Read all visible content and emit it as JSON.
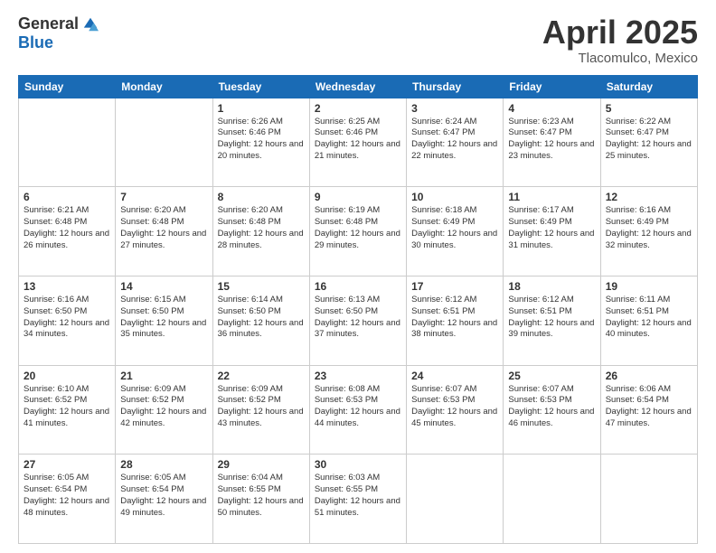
{
  "header": {
    "logo_general": "General",
    "logo_blue": "Blue",
    "month_title": "April 2025",
    "location": "Tlacomulco, Mexico"
  },
  "days_of_week": [
    "Sunday",
    "Monday",
    "Tuesday",
    "Wednesday",
    "Thursday",
    "Friday",
    "Saturday"
  ],
  "weeks": [
    [
      {
        "day": "",
        "sunrise": "",
        "sunset": "",
        "daylight": ""
      },
      {
        "day": "",
        "sunrise": "",
        "sunset": "",
        "daylight": ""
      },
      {
        "day": "1",
        "sunrise": "Sunrise: 6:26 AM",
        "sunset": "Sunset: 6:46 PM",
        "daylight": "Daylight: 12 hours and 20 minutes."
      },
      {
        "day": "2",
        "sunrise": "Sunrise: 6:25 AM",
        "sunset": "Sunset: 6:46 PM",
        "daylight": "Daylight: 12 hours and 21 minutes."
      },
      {
        "day": "3",
        "sunrise": "Sunrise: 6:24 AM",
        "sunset": "Sunset: 6:47 PM",
        "daylight": "Daylight: 12 hours and 22 minutes."
      },
      {
        "day": "4",
        "sunrise": "Sunrise: 6:23 AM",
        "sunset": "Sunset: 6:47 PM",
        "daylight": "Daylight: 12 hours and 23 minutes."
      },
      {
        "day": "5",
        "sunrise": "Sunrise: 6:22 AM",
        "sunset": "Sunset: 6:47 PM",
        "daylight": "Daylight: 12 hours and 25 minutes."
      }
    ],
    [
      {
        "day": "6",
        "sunrise": "Sunrise: 6:21 AM",
        "sunset": "Sunset: 6:48 PM",
        "daylight": "Daylight: 12 hours and 26 minutes."
      },
      {
        "day": "7",
        "sunrise": "Sunrise: 6:20 AM",
        "sunset": "Sunset: 6:48 PM",
        "daylight": "Daylight: 12 hours and 27 minutes."
      },
      {
        "day": "8",
        "sunrise": "Sunrise: 6:20 AM",
        "sunset": "Sunset: 6:48 PM",
        "daylight": "Daylight: 12 hours and 28 minutes."
      },
      {
        "day": "9",
        "sunrise": "Sunrise: 6:19 AM",
        "sunset": "Sunset: 6:48 PM",
        "daylight": "Daylight: 12 hours and 29 minutes."
      },
      {
        "day": "10",
        "sunrise": "Sunrise: 6:18 AM",
        "sunset": "Sunset: 6:49 PM",
        "daylight": "Daylight: 12 hours and 30 minutes."
      },
      {
        "day": "11",
        "sunrise": "Sunrise: 6:17 AM",
        "sunset": "Sunset: 6:49 PM",
        "daylight": "Daylight: 12 hours and 31 minutes."
      },
      {
        "day": "12",
        "sunrise": "Sunrise: 6:16 AM",
        "sunset": "Sunset: 6:49 PM",
        "daylight": "Daylight: 12 hours and 32 minutes."
      }
    ],
    [
      {
        "day": "13",
        "sunrise": "Sunrise: 6:16 AM",
        "sunset": "Sunset: 6:50 PM",
        "daylight": "Daylight: 12 hours and 34 minutes."
      },
      {
        "day": "14",
        "sunrise": "Sunrise: 6:15 AM",
        "sunset": "Sunset: 6:50 PM",
        "daylight": "Daylight: 12 hours and 35 minutes."
      },
      {
        "day": "15",
        "sunrise": "Sunrise: 6:14 AM",
        "sunset": "Sunset: 6:50 PM",
        "daylight": "Daylight: 12 hours and 36 minutes."
      },
      {
        "day": "16",
        "sunrise": "Sunrise: 6:13 AM",
        "sunset": "Sunset: 6:50 PM",
        "daylight": "Daylight: 12 hours and 37 minutes."
      },
      {
        "day": "17",
        "sunrise": "Sunrise: 6:12 AM",
        "sunset": "Sunset: 6:51 PM",
        "daylight": "Daylight: 12 hours and 38 minutes."
      },
      {
        "day": "18",
        "sunrise": "Sunrise: 6:12 AM",
        "sunset": "Sunset: 6:51 PM",
        "daylight": "Daylight: 12 hours and 39 minutes."
      },
      {
        "day": "19",
        "sunrise": "Sunrise: 6:11 AM",
        "sunset": "Sunset: 6:51 PM",
        "daylight": "Daylight: 12 hours and 40 minutes."
      }
    ],
    [
      {
        "day": "20",
        "sunrise": "Sunrise: 6:10 AM",
        "sunset": "Sunset: 6:52 PM",
        "daylight": "Daylight: 12 hours and 41 minutes."
      },
      {
        "day": "21",
        "sunrise": "Sunrise: 6:09 AM",
        "sunset": "Sunset: 6:52 PM",
        "daylight": "Daylight: 12 hours and 42 minutes."
      },
      {
        "day": "22",
        "sunrise": "Sunrise: 6:09 AM",
        "sunset": "Sunset: 6:52 PM",
        "daylight": "Daylight: 12 hours and 43 minutes."
      },
      {
        "day": "23",
        "sunrise": "Sunrise: 6:08 AM",
        "sunset": "Sunset: 6:53 PM",
        "daylight": "Daylight: 12 hours and 44 minutes."
      },
      {
        "day": "24",
        "sunrise": "Sunrise: 6:07 AM",
        "sunset": "Sunset: 6:53 PM",
        "daylight": "Daylight: 12 hours and 45 minutes."
      },
      {
        "day": "25",
        "sunrise": "Sunrise: 6:07 AM",
        "sunset": "Sunset: 6:53 PM",
        "daylight": "Daylight: 12 hours and 46 minutes."
      },
      {
        "day": "26",
        "sunrise": "Sunrise: 6:06 AM",
        "sunset": "Sunset: 6:54 PM",
        "daylight": "Daylight: 12 hours and 47 minutes."
      }
    ],
    [
      {
        "day": "27",
        "sunrise": "Sunrise: 6:05 AM",
        "sunset": "Sunset: 6:54 PM",
        "daylight": "Daylight: 12 hours and 48 minutes."
      },
      {
        "day": "28",
        "sunrise": "Sunrise: 6:05 AM",
        "sunset": "Sunset: 6:54 PM",
        "daylight": "Daylight: 12 hours and 49 minutes."
      },
      {
        "day": "29",
        "sunrise": "Sunrise: 6:04 AM",
        "sunset": "Sunset: 6:55 PM",
        "daylight": "Daylight: 12 hours and 50 minutes."
      },
      {
        "day": "30",
        "sunrise": "Sunrise: 6:03 AM",
        "sunset": "Sunset: 6:55 PM",
        "daylight": "Daylight: 12 hours and 51 minutes."
      },
      {
        "day": "",
        "sunrise": "",
        "sunset": "",
        "daylight": ""
      },
      {
        "day": "",
        "sunrise": "",
        "sunset": "",
        "daylight": ""
      },
      {
        "day": "",
        "sunrise": "",
        "sunset": "",
        "daylight": ""
      }
    ]
  ]
}
